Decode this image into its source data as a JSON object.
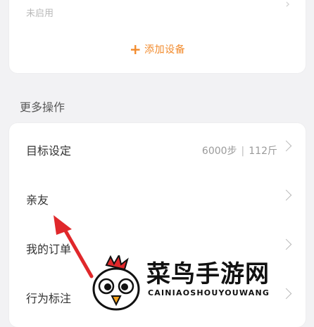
{
  "device_card": {
    "status_text": "未启用",
    "add_device_label": "添加设备",
    "accent_color": "#f28a2b"
  },
  "more_actions": {
    "section_title": "更多操作",
    "items": [
      {
        "label": "目标设定",
        "steps": "6000步",
        "weight": "112斤"
      },
      {
        "label": "亲友"
      },
      {
        "label": "我的订单"
      },
      {
        "label": "行为标注"
      }
    ]
  },
  "annotation": {
    "color": "#e0282b"
  },
  "watermark": {
    "title": "菜鸟手游网",
    "subtitle": "CAINIAOSHOUYOUWANG"
  }
}
